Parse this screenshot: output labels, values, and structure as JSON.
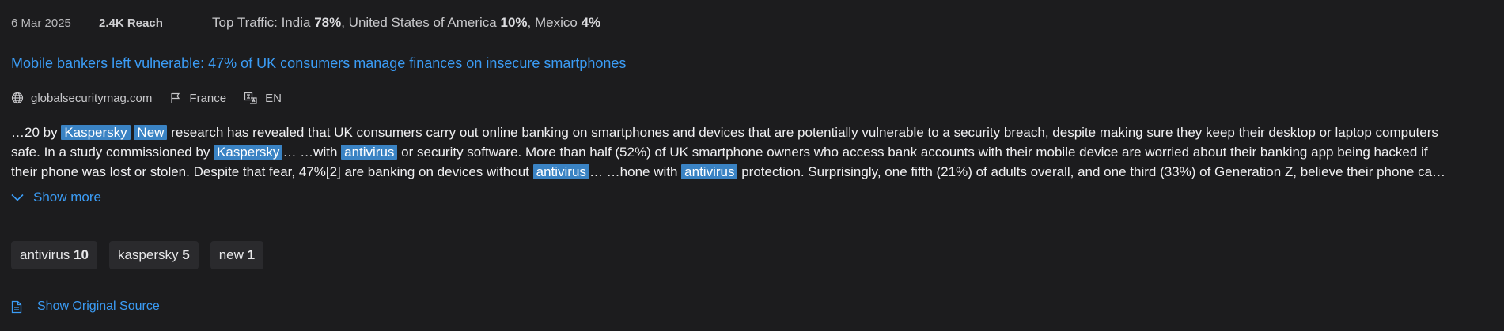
{
  "meta": {
    "date": "6 Mar 2025",
    "reach": "2.4K Reach",
    "top_traffic_label": "Top Traffic:",
    "traffic": [
      {
        "country": "India",
        "pct": "78%"
      },
      {
        "country": "United States of America",
        "pct": "10%"
      },
      {
        "country": "Mexico",
        "pct": "4%"
      }
    ]
  },
  "article": {
    "title": "Mobile bankers left vulnerable: 47% of UK consumers manage finances on insecure smartphones",
    "domain": "globalsecuritymag.com",
    "country": "France",
    "language": "EN"
  },
  "snippet": {
    "line1": [
      "…20 by ",
      {
        "hl": "Kaspersky"
      },
      " ",
      {
        "hl": "New"
      },
      " research has revealed that UK consumers carry out online banking on smartphones and devices that are potentially vulnerable to a security breach, despite making sure they keep their desktop or laptop computers"
    ],
    "line2": [
      "safe. In a study commissioned by ",
      {
        "hl": "Kaspersky"
      },
      "… …with ",
      {
        "hl": "antivirus"
      },
      " or security software. More than half (52%) of UK smartphone owners who access bank accounts with their mobile device are worried about their banking app being hacked if"
    ],
    "line3": [
      "their phone was lost or stolen. Despite that fear, 47%[2] are banking on devices without ",
      {
        "hl": "antivirus"
      },
      "… …hone with ",
      {
        "hl": "antivirus"
      },
      " protection. Surprisingly, one fifth (21%) of adults overall, and one third (33%) of Generation Z, believe their phone ca…"
    ]
  },
  "show_more_label": "Show more",
  "tags": [
    {
      "name": "antivirus",
      "count": "10"
    },
    {
      "name": "kaspersky",
      "count": "5"
    },
    {
      "name": "new",
      "count": "1"
    }
  ],
  "show_original_label": "Show Original Source"
}
